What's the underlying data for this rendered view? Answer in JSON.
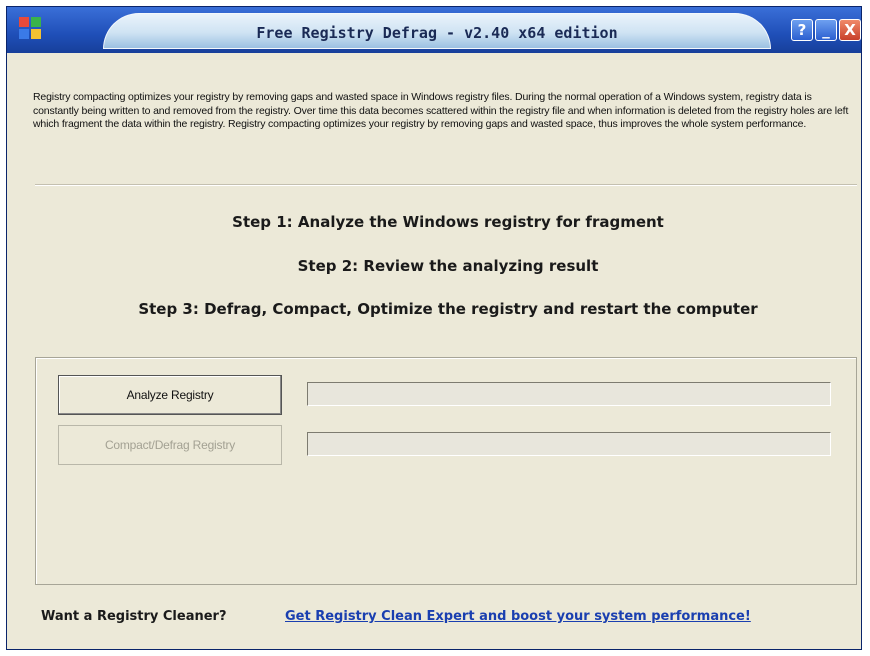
{
  "window": {
    "title": "Free Registry Defrag - v2.40 x64 edition",
    "buttons": {
      "help": "?",
      "minimize": "_",
      "close": "X"
    }
  },
  "description": "Registry compacting optimizes your registry by removing gaps and wasted space in Windows registry files. During the normal operation of a Windows system, registry data is constantly being written to and removed from the registry. Over time this data becomes scattered within the registry file and when information is deleted from the registry holes are left which fragment the data within the registry. Registry compacting optimizes your registry by removing gaps and wasted space, thus improves the whole system performance.",
  "steps": [
    "Step 1: Analyze the Windows registry for fragment",
    "Step 2: Review the analyzing result",
    "Step 3: Defrag, Compact, Optimize the registry and restart the computer"
  ],
  "actions": {
    "analyze_label": "Analyze Registry",
    "compact_label": "Compact/Defrag Registry",
    "analyze_progress": 0,
    "compact_progress": 0
  },
  "footer": {
    "question": "Want a Registry Cleaner?",
    "link": "Get Registry Clean Expert and boost your system performance!"
  },
  "colors": {
    "titlebar": "#1f4fb8",
    "window_bg": "#ece9d8",
    "link": "#1a3fb0",
    "close": "#c8402a"
  }
}
